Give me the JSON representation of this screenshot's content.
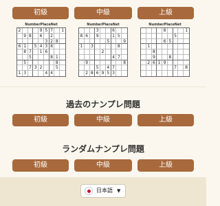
{
  "top_buttons": [
    "初級",
    "中級",
    "上級"
  ],
  "puzzles": [
    {
      "brand": "NumberPlaceNet",
      "grid": [
        [
          "2",
          "",
          "",
          "",
          "9",
          "5",
          "7",
          "",
          "1"
        ],
        [
          "",
          "9",
          "8",
          "",
          "6",
          "",
          "2",
          "",
          ""
        ],
        [
          "",
          "",
          "",
          "",
          "",
          "3",
          "2",
          "8",
          ""
        ],
        [
          "6",
          "1",
          "",
          "5",
          "4",
          "3",
          "8",
          "",
          ""
        ],
        [
          "",
          "8",
          "7",
          "",
          "1",
          "6",
          "",
          "",
          ""
        ],
        [
          "",
          "",
          "5",
          "",
          "",
          "",
          "8",
          "1",
          ""
        ],
        [
          "",
          "5",
          "",
          "",
          "",
          "",
          "",
          "8",
          "",
          ""
        ],
        [
          "",
          "",
          "7",
          "3",
          "2",
          "",
          "",
          "5",
          ""
        ],
        [
          "1",
          "3",
          "",
          "",
          "",
          "4",
          "4",
          "",
          ""
        ]
      ]
    },
    {
      "brand": "NumberPlaceNet",
      "grid": [
        [
          "",
          "",
          "",
          "3",
          "",
          "",
          "6",
          "",
          ""
        ],
        [
          "8",
          "6",
          "",
          "9",
          "",
          "",
          "1",
          "5",
          ""
        ],
        [
          "",
          "",
          "",
          "",
          "",
          "5",
          "",
          "",
          "9"
        ],
        [
          "1",
          "",
          "3",
          "",
          "",
          "",
          "",
          "8",
          "",
          ""
        ],
        [
          "",
          "",
          "",
          "",
          "2",
          "",
          "",
          "",
          ""
        ],
        [
          "",
          "",
          "",
          "",
          "",
          "",
          "4",
          "7",
          "",
          ""
        ],
        [
          "",
          "9",
          "",
          "",
          "",
          "",
          "",
          "",
          "8"
        ],
        [
          "",
          "",
          "",
          "5",
          "",
          "4",
          "7",
          "",
          ""
        ],
        [
          "",
          "2",
          "8",
          "6",
          "9",
          "5",
          "3",
          "",
          ""
        ]
      ]
    },
    {
      "brand": "NumberPlaceNet",
      "grid": [
        [
          "",
          "",
          "",
          "",
          "8",
          "",
          "",
          "",
          "1"
        ],
        [
          "",
          "",
          "",
          "",
          "",
          "",
          "5",
          "",
          ""
        ],
        [
          "",
          "",
          "",
          "",
          "6",
          "5",
          "",
          "",
          ""
        ],
        [
          "",
          "1",
          "",
          "",
          "",
          "",
          "",
          "",
          ""
        ],
        [
          "",
          "",
          "8",
          "",
          "",
          "",
          "",
          "",
          ""
        ],
        [
          "",
          "",
          "9",
          "",
          "",
          "8",
          "",
          "",
          ""
        ],
        [
          "",
          "2",
          "6",
          "1",
          "9",
          "",
          "",
          "",
          ""
        ],
        [
          "",
          "",
          "",
          "",
          "",
          "",
          "7",
          "",
          "8"
        ],
        [
          "",
          "",
          "",
          "",
          "",
          "",
          "",
          "",
          ""
        ]
      ]
    }
  ],
  "past": {
    "title": "過去のナンプレ問題",
    "buttons": [
      "初級",
      "中級",
      "上級"
    ]
  },
  "random": {
    "title": "ランダムナンプレ問題",
    "buttons": [
      "初級",
      "中級",
      "上級"
    ]
  },
  "footer": {
    "language_label": "日本語",
    "caret": "▼",
    "flag_icon": "japan-flag-icon"
  }
}
